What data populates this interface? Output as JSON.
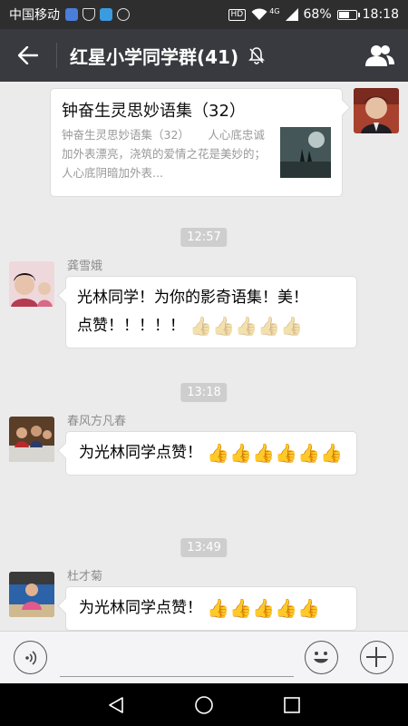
{
  "status_bar": {
    "carrier": "中国移动",
    "battery": "68%",
    "battery_level": 0.68,
    "network": "4G",
    "hd": "HD",
    "time": "18:18"
  },
  "header": {
    "title": "红星小学同学群(41)"
  },
  "messages": {
    "shared_card": {
      "title": "钟奋生灵思妙语集（32）",
      "description": "钟奋生灵思妙语集（32） 　 人心底忠诚加外表漂亮，浇筑的爱情之花是美妙的；人心底阴暗加外表..."
    },
    "time_1": "12:57",
    "msg_1": {
      "sender": "龚雪娥",
      "text_line1": "光林同学！为你的影奇语集！美！",
      "text_line2": "点赞！！！！！",
      "thumbs": [
        "👍",
        "👍",
        "👍",
        "👍",
        "👍"
      ]
    },
    "time_2": "13:18",
    "msg_2": {
      "sender": "春风方凡春",
      "text": "为光林同学点赞！",
      "thumbs": [
        "👍",
        "👍",
        "👍",
        "👍",
        "👍",
        "👍"
      ]
    },
    "time_3": "13:49",
    "msg_3": {
      "sender": "杜才菊",
      "text": "为光林同学点赞！",
      "thumbs": [
        "👍",
        "👍",
        "👍",
        "👍",
        "👍"
      ]
    }
  },
  "input_bar": {
    "placeholder": ""
  },
  "colors": {
    "title_bar": "#393a3f",
    "status_bar": "#2e2e2e",
    "chat_background": "#ebebeb",
    "time_pill": "#cecece"
  },
  "icons": {
    "back": "back-arrow-icon",
    "mute": "mute-bell-icon",
    "members": "group-members-icon",
    "voice": "voice-icon",
    "emoji": "emoji-icon",
    "plus": "plus-icon"
  }
}
